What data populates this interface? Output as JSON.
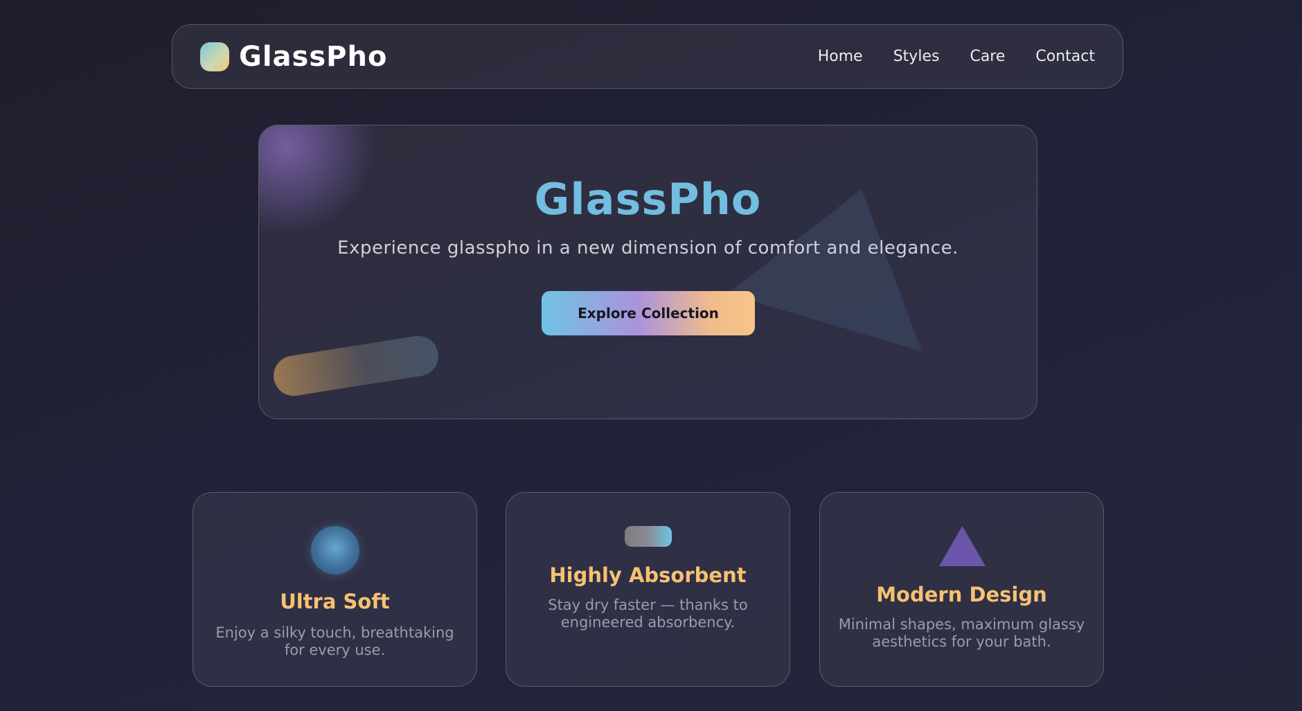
{
  "brand": {
    "name": "GlassPho"
  },
  "nav": {
    "links": [
      "Home",
      "Styles",
      "Care",
      "Contact"
    ]
  },
  "hero": {
    "title": "GlassPho",
    "subtitle": "Experience glasspho in a new dimension of comfort and elegance.",
    "button_label": "Explore Collection"
  },
  "features": [
    {
      "icon": "orb-icon",
      "title": "Ultra Soft",
      "description": "Enjoy a silky touch, breathtaking for every use."
    },
    {
      "icon": "toggle-icon",
      "title": "Highly Absorbent",
      "description": "Stay dry faster — thanks to engineered absorbency."
    },
    {
      "icon": "triangle-icon",
      "title": "Modern Design",
      "description": "Minimal shapes, maximum glassy aesthetics for your bath."
    }
  ],
  "colors": {
    "background": "#1f1f2e",
    "accent_blue": "#72bde0",
    "accent_gold": "#f6c171",
    "accent_purple": "#ab93dc"
  }
}
